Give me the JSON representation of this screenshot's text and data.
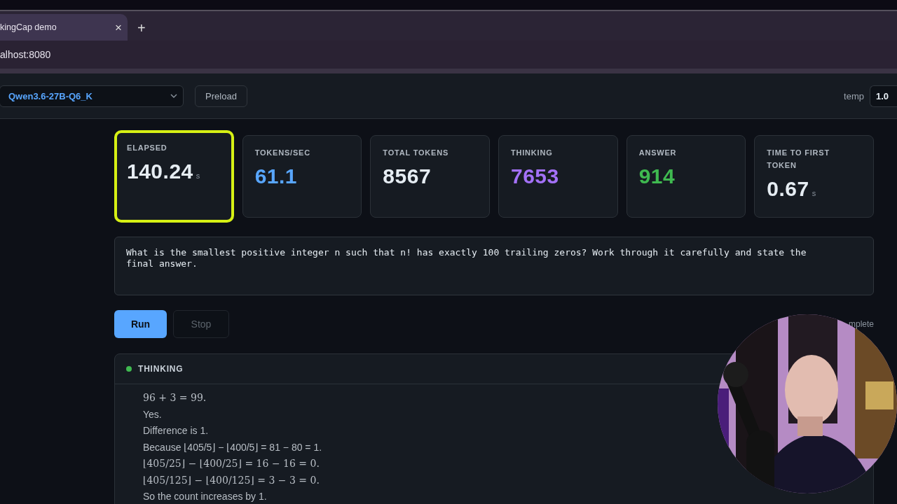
{
  "browser": {
    "tab": {
      "title": "kingCap demo",
      "close": "×"
    },
    "new_tab": "+",
    "address": "alhost:8080"
  },
  "toolbar": {
    "model": "Qwen3.6-27B-Q6_K",
    "preload": "Preload",
    "temp_label": "temp",
    "temp_value": "1.0"
  },
  "stats": [
    {
      "label": "ELAPSED",
      "value": "140.24",
      "unit": "s",
      "color": "#e6edf3",
      "highlighted": true
    },
    {
      "label": "TOKENS/SEC",
      "value": "61.1",
      "color": "#58a6ff",
      "highlighted": false
    },
    {
      "label": "TOTAL TOKENS",
      "value": "8567",
      "color": "#e6edf3",
      "highlighted": false
    },
    {
      "label": "THINKING",
      "value": "7653",
      "color": "#a371f7",
      "highlighted": false
    },
    {
      "label": "ANSWER",
      "value": "914",
      "color": "#3fb950",
      "highlighted": false
    },
    {
      "label": "TIME TO FIRST TOKEN",
      "value": "0.67",
      "unit": "s",
      "color": "#e6edf3",
      "highlighted": false
    }
  ],
  "prompt": "What is the smallest positive integer n such that n! has exactly 100 trailing zeros? Work through it carefully and state the final answer.",
  "actions": {
    "run": "Run",
    "stop": "Stop",
    "status": "mplete"
  },
  "thinking": {
    "title": "THINKING",
    "active": true,
    "lines": [
      {
        "kind": "math",
        "text": "96 + 3 = 99."
      },
      {
        "kind": "text",
        "text": "Yes."
      },
      {
        "kind": "text",
        "text": "Difference is 1."
      },
      {
        "kind": "text",
        "text": "Because ⌊405/5⌋ − ⌊400/5⌋ = 81 − 80 = 1."
      },
      {
        "kind": "math",
        "text": "⌊405/25⌋ − ⌊400/25⌋ = 16 − 16 = 0."
      },
      {
        "kind": "math",
        "text": "⌊405/125⌋ − ⌊400/125⌋ = 3 − 3 = 0."
      },
      {
        "kind": "text",
        "text": "So the count increases by 1."
      }
    ]
  }
}
